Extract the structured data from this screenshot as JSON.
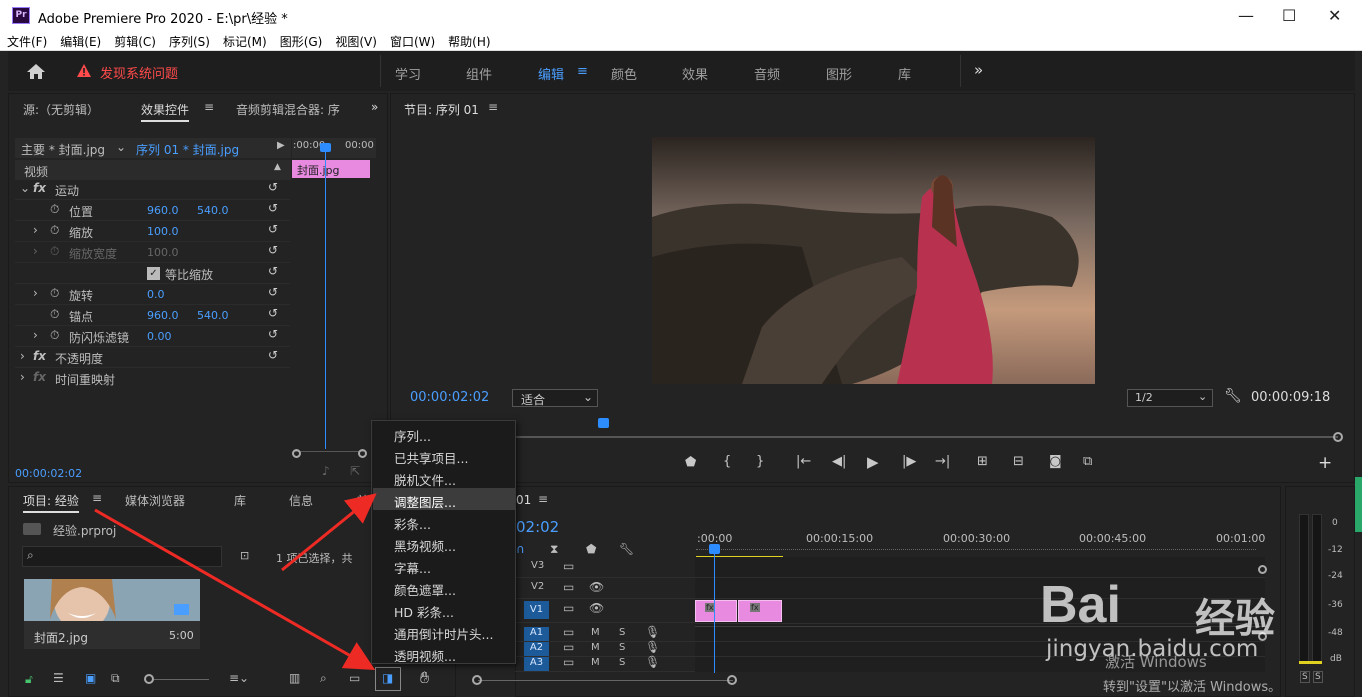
{
  "window": {
    "app_icon": "Pr",
    "title": "Adobe Premiere Pro 2020 - E:\\pr\\经验 *",
    "controls": [
      "—",
      "☐",
      "✕"
    ]
  },
  "menubar": [
    "文件(F)",
    "编辑(E)",
    "剪辑(C)",
    "序列(S)",
    "标记(M)",
    "图形(G)",
    "视图(V)",
    "窗口(W)",
    "帮助(H)"
  ],
  "topbar": {
    "warning": "发现系统问题",
    "workspaces": [
      "学习",
      "组件",
      "编辑",
      "颜色",
      "效果",
      "音频",
      "图形",
      "库"
    ],
    "active_workspace": "编辑",
    "more": "»"
  },
  "source_panel": {
    "tabs": [
      "源:（无剪辑）",
      "效果控件",
      "音频剪辑混合器: 序"
    ],
    "active_tab": "效果控件",
    "header_master": "主要 * 封面.jpg",
    "header_sequence": "序列 01 * 封面.jpg",
    "ruler_start": ":00:00",
    "ruler_end": "00:00",
    "clip_label": "封面.jpg",
    "section_video": "视频",
    "motion": "运动",
    "position_label": "位置",
    "position_x": "960.0",
    "position_y": "540.0",
    "scale_label": "缩放",
    "scale_value": "100.0",
    "scale_width_label": "缩放宽度",
    "scale_width_value": "100.0",
    "uniform_label": "等比缩放",
    "rotation_label": "旋转",
    "rotation_value": "0.0",
    "anchor_label": "锚点",
    "anchor_x": "960.0",
    "anchor_y": "540.0",
    "flicker_label": "防闪烁滤镜",
    "flicker_value": "0.00",
    "opacity": "不透明度",
    "time_remap": "时间重映射",
    "timecode": "00:00:02:02"
  },
  "program_monitor": {
    "title": "节目: 序列 01",
    "timecode": "00:00:02:02",
    "fit": "适合",
    "resolution": "1/2",
    "duration": "00:00:09:18"
  },
  "project_panel": {
    "tabs": [
      "项目: 经验",
      "媒体浏览器",
      "库",
      "信息",
      "效"
    ],
    "project_file": "经验.prproj",
    "status": "1 项已选择，共",
    "clip_name": "封面2.jpg",
    "clip_duration": "5:00"
  },
  "new_item_menu": [
    "序列...",
    "已共享项目...",
    "脱机文件...",
    "调整图层...",
    "彩条...",
    "黑场视频...",
    "字幕...",
    "颜色遮罩...",
    "HD 彩条...",
    "通用倒计时片头...",
    "透明视频..."
  ],
  "new_item_menu_highlighted": 3,
  "timeline": {
    "title": "01",
    "timecode": "02:02",
    "ruler": [
      ":00:00",
      "00:00:15:00",
      "00:00:30:00",
      "00:00:45:00",
      "00:01:00"
    ],
    "video_tracks": [
      "V3",
      "V2",
      "V1"
    ],
    "audio_tracks": [
      "A1",
      "A2",
      "A3"
    ],
    "m": "M",
    "s": "S",
    "clip_fx": "fx"
  },
  "meter": {
    "labels": [
      "0",
      "-12",
      "-24",
      "-36",
      "-48",
      "dB"
    ],
    "solo": "S"
  },
  "watermark": {
    "brand": "Bai",
    "brand2": "经验",
    "url": "jingyan.baidu.com",
    "activate1": "激活 Windows",
    "activate2": "转到\"设置\"以激活 Windows。"
  },
  "colors": {
    "accent": "#4a9eff",
    "clip_pink": "#e78ae0",
    "warning": "#ff4b4b",
    "playhead": "#2d8cff",
    "arrow": "#ee2a24"
  }
}
